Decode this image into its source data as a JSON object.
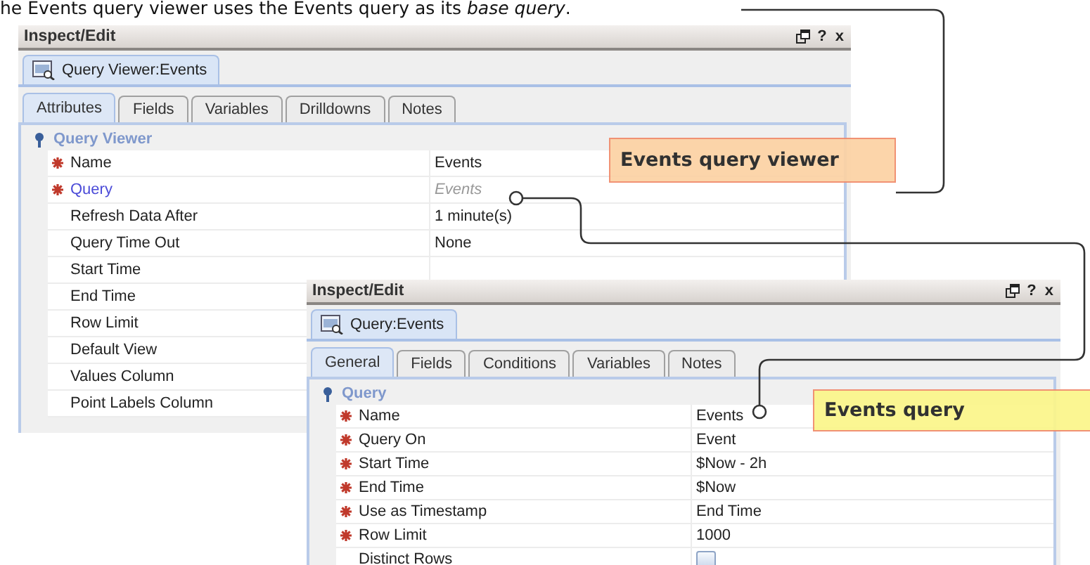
{
  "caption": "he Events query viewer uses the Events query as its *base query*.",
  "windows": [
    {
      "title": "Inspect/Edit",
      "help": "?",
      "close": "x",
      "document_tab": {
        "label": "Query Viewer:Events",
        "selected": true
      },
      "tabs": [
        {
          "label": "Attributes",
          "selected": true
        },
        {
          "label": "Fields",
          "selected": false
        },
        {
          "label": "Variables",
          "selected": false
        },
        {
          "label": "Drilldowns",
          "selected": false
        },
        {
          "label": "Notes",
          "selected": false
        }
      ],
      "section": "Query Viewer",
      "rows": [
        {
          "kind": "text",
          "label": "Name",
          "required": true,
          "value": "Events"
        },
        {
          "kind": "link",
          "label": "Query",
          "required": true,
          "value": "Events"
        },
        {
          "kind": "text",
          "label": "Refresh Data After",
          "required": false,
          "value": "1 minute(s)"
        },
        {
          "kind": "text",
          "label": "Query Time Out",
          "required": false,
          "value": "None"
        },
        {
          "kind": "text",
          "label": "Start Time",
          "required": false
        },
        {
          "kind": "text",
          "label": "End Time",
          "required": false
        },
        {
          "kind": "text",
          "label": "Row Limit",
          "required": false
        },
        {
          "kind": "text",
          "label": "Default View",
          "required": false
        },
        {
          "kind": "text",
          "label": "Values Column",
          "required": false
        },
        {
          "kind": "text",
          "label": "Point Labels Column",
          "required": false
        }
      ],
      "callout": {
        "text": "Events query viewer",
        "color": "#fcd2a4"
      }
    },
    {
      "title": "Inspect/Edit",
      "help": "?",
      "close": "x",
      "document_tab": {
        "label": "Query:Events",
        "selected": true
      },
      "tabs": [
        {
          "label": "General",
          "selected": true
        },
        {
          "label": "Fields",
          "selected": false
        },
        {
          "label": "Conditions",
          "selected": false
        },
        {
          "label": "Variables",
          "selected": false
        },
        {
          "label": "Notes",
          "selected": false
        }
      ],
      "section": "Query",
      "rows": [
        {
          "kind": "text",
          "label": "Name",
          "required": true,
          "value": "Events"
        },
        {
          "kind": "text",
          "label": "Query On",
          "required": true,
          "value": "Event"
        },
        {
          "kind": "text",
          "label": "Start Time",
          "required": true,
          "value": "$Now - 2h"
        },
        {
          "kind": "text",
          "label": "End Time",
          "required": true,
          "value": "$Now"
        },
        {
          "kind": "text",
          "label": "Use as Timestamp",
          "required": true,
          "value": "End Time"
        },
        {
          "kind": "text",
          "label": "Row Limit",
          "required": true,
          "value": "1000"
        },
        {
          "kind": "checkbox",
          "label": "Distinct Rows",
          "required": false,
          "checked": false
        }
      ],
      "callout": {
        "text": "Events query",
        "color": "#fbf68a"
      }
    }
  ]
}
